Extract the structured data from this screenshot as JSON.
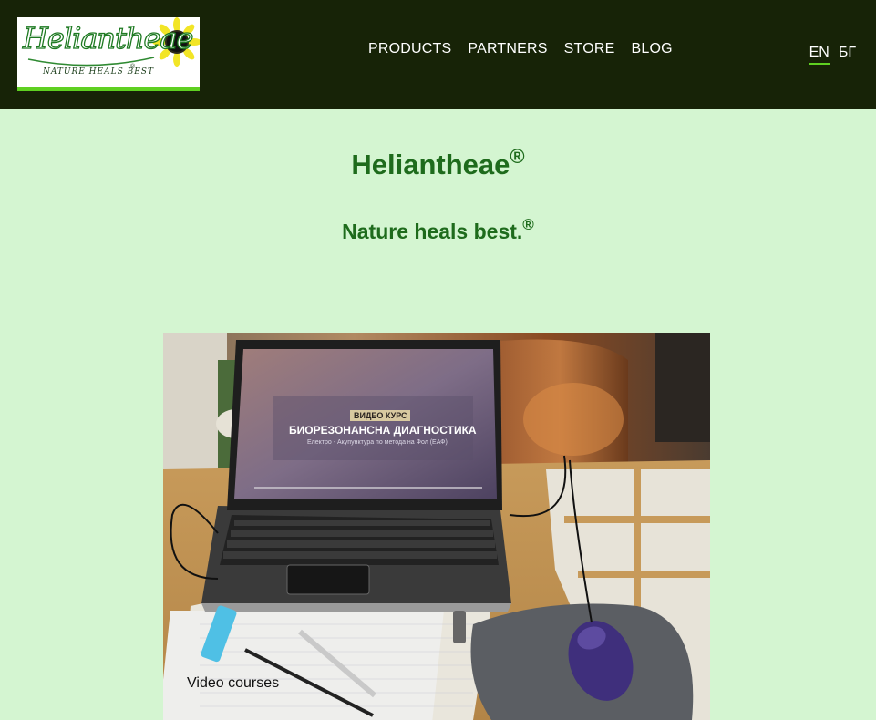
{
  "logo": {
    "wordmark": "Heliantheae",
    "tagline": "NATURE HEALS BEST",
    "mark": "®",
    "accent": "#5fd021"
  },
  "nav": {
    "items": [
      {
        "label": "PRODUCTS"
      },
      {
        "label": "PARTNERS"
      },
      {
        "label": "STORE"
      },
      {
        "label": "BLOG"
      }
    ]
  },
  "language": {
    "options": [
      {
        "label": "EN",
        "active": true
      },
      {
        "label": "БГ",
        "active": false
      }
    ]
  },
  "hero": {
    "title": "Heliantheae",
    "title_mark": "®",
    "subtitle": "Nature heals best.",
    "subtitle_mark": "®"
  },
  "feature": {
    "caption": "Video courses",
    "screen_badge": "ВИДЕО КУРС",
    "screen_title": "БИОРЕЗОНАНСНА ДИАГНОСТИКА",
    "screen_subtitle": "Електро - Акупунктура по метода на Фол (ЕАФ)"
  },
  "colors": {
    "header_bg": "#172307",
    "page_bg": "#d4f5d1",
    "heading": "#1e6b1c",
    "accent_green": "#5fd021"
  }
}
